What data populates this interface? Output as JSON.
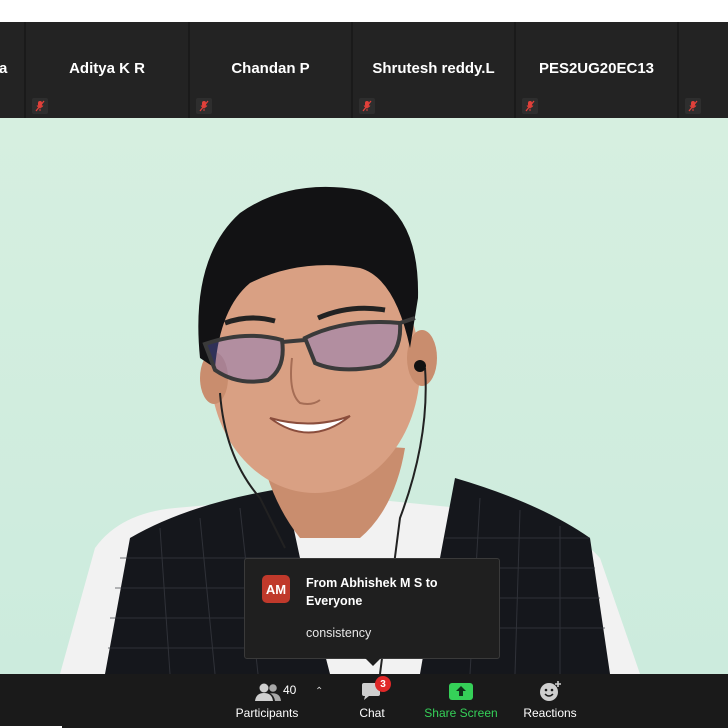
{
  "gallery": {
    "tiles": [
      {
        "name": "a"
      },
      {
        "name": "Aditya K R"
      },
      {
        "name": "Chandan P"
      },
      {
        "name": "Shrutesh reddy.L"
      },
      {
        "name": "PES2UG20EC13"
      }
    ]
  },
  "chat_notification": {
    "avatar_initials": "AM",
    "from_line": "From Abhishek M S to Everyone",
    "message": "consistency"
  },
  "toolbar": {
    "participants_label": "Participants",
    "participants_count": "40",
    "chat_label": "Chat",
    "chat_badge": "3",
    "share_label": "Share Screen",
    "reactions_label": "Reactions"
  },
  "colors": {
    "share_green": "#35d058",
    "badge_red": "#e02828",
    "avatar_red": "#c0392b"
  }
}
